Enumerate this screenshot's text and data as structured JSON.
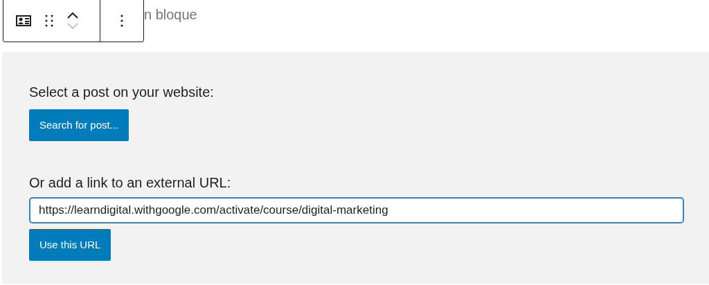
{
  "block_placeholder": "n bloque",
  "toolbar": {
    "move_up_disabled": false,
    "move_down_disabled": true
  },
  "post_search": {
    "label": "Select a post on your website:",
    "button": "Search for post..."
  },
  "external_url": {
    "label": "Or add a link to an external URL:",
    "value": "https://learndigital.withgoogle.com/activate/course/digital-marketing",
    "button": "Use this URL"
  }
}
